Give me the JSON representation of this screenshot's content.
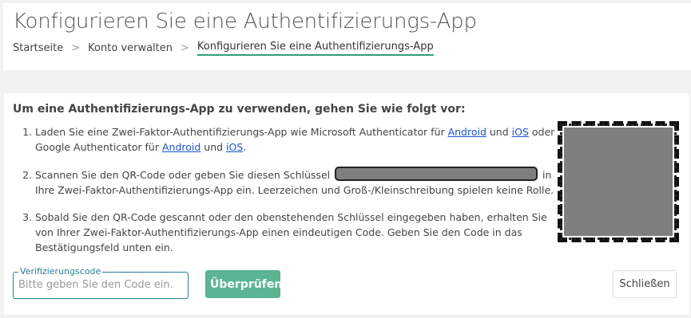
{
  "header": {
    "title": "Konfigurieren Sie eine Authentifizierungs-App",
    "breadcrumb": {
      "home": "Startseite",
      "separator": ">",
      "account": "Konto verwalten",
      "current": "Konfigurieren Sie eine Authentifizierungs-App"
    }
  },
  "instructions": {
    "intro": "Um eine Authentifizierungs-App zu verwenden, gehen Sie wie folgt vor:",
    "step1": {
      "text_a": "Laden Sie eine Zwei-Faktor-Authentifizierungs-App wie Microsoft Authenticator für ",
      "link_android_1": "Android",
      "text_b": " und ",
      "link_ios_1": "iOS",
      "text_c": " oder Google Authenticator für ",
      "link_android_2": "Android",
      "text_d": " und ",
      "link_ios_2": "iOS",
      "text_e": "."
    },
    "step2": {
      "text_a": "Scannen Sie den QR-Code oder geben Sie diesen Schlüssel ",
      "text_b": " in Ihre Zwei-Faktor-Authentifizierungs-App ein. Leerzeichen und Groß-/Kleinschreibung spielen keine Rolle."
    },
    "step3": {
      "text": "Sobald Sie den QR-Code gescannt oder den obenstehenden Schlüssel eingegeben haben, erhalten Sie von Ihrer Zwei-Faktor-Authentifizierungs-App einen eindeutigen Code. Geben Sie den Code in das Bestätigungsfeld unten ein."
    }
  },
  "form": {
    "code_label": "Verifizierungscode",
    "code_placeholder": "Bitte geben Sie den Code ein.",
    "code_value": "",
    "verify_label": "Überprüfen",
    "close_label": "Schließen"
  },
  "colors": {
    "accent_green": "#5bb592",
    "breadcrumb_underline": "#2e9e77",
    "link": "#1a55c9",
    "field_border": "#2a7d9a",
    "redaction": "#7f7f7f"
  }
}
